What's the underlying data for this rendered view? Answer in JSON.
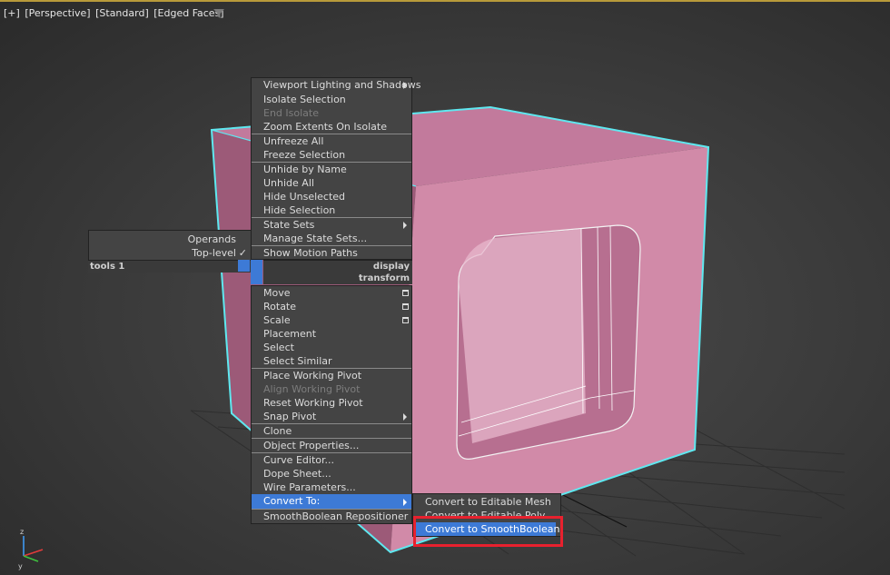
{
  "viewport": {
    "labels": [
      "[+]",
      "[Perspective]",
      "[Standard]",
      "[Edged Faces]"
    ],
    "filter_icon": "funnel-icon"
  },
  "left_quad": {
    "items": [
      "Operands",
      "Top-level"
    ],
    "quad_name": "tools 1"
  },
  "quad_headers": {
    "display": "display",
    "transform": "transform"
  },
  "display_quad": [
    "Viewport Lighting and Shadows",
    "Isolate Selection",
    "End Isolate",
    "Zoom Extents On Isolate",
    "Unfreeze All",
    "Freeze Selection",
    "Unhide by Name",
    "Unhide All",
    "Hide Unselected",
    "Hide Selection",
    "State Sets",
    "Manage State Sets...",
    "Show Motion Paths"
  ],
  "transform_quad": [
    "Move",
    "Rotate",
    "Scale",
    "Placement",
    "Select",
    "Select Similar",
    "Place Working Pivot",
    "Align Working Pivot",
    "Reset Working Pivot",
    "Snap Pivot",
    "Clone",
    "Object Properties...",
    "Curve Editor...",
    "Dope Sheet...",
    "Wire Parameters...",
    "Convert To:",
    "SmoothBoolean Repositioner"
  ],
  "submenu": [
    "Convert to Editable Mesh",
    "Convert to Editable Poly",
    "Convert to SmoothBoolean"
  ],
  "colors": {
    "highlight": "#3d7ad6",
    "object": "#d18aa8",
    "selection_outline": "#5ee8f0",
    "callout": "#e8212e"
  }
}
